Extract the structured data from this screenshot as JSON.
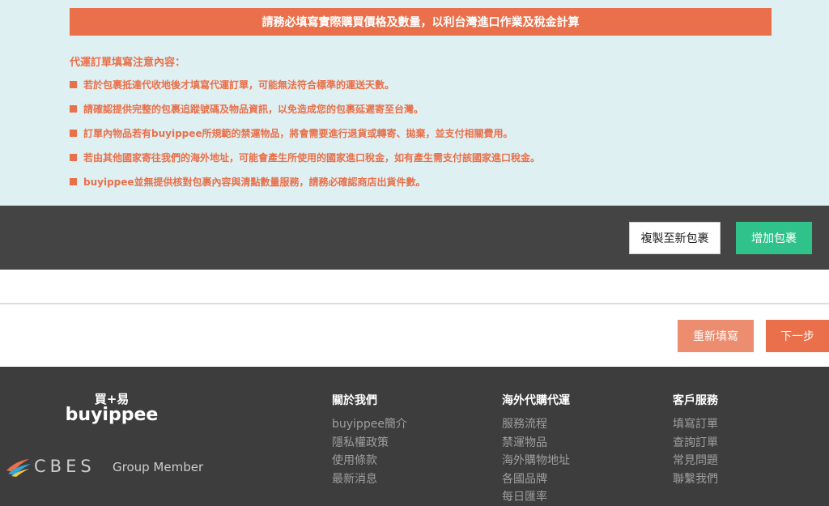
{
  "notice": {
    "banner": "請務必填寫實際購買價格及數量，以利台灣進口作業及稅金計算",
    "title": "代運訂單填寫注意內容：",
    "items": [
      "若於包裹抵達代收地後才填寫代運訂單，可能無法符合標準的運送天數。",
      "請確認提供完整的包裹追蹤號碼及物品資訊，以免造成您的包裹延遲寄至台灣。",
      "訂單內物品若有buyippee所規範的禁運物品，將會需要進行退貨或轉寄、拋棄，並支付相關費用。",
      "若由其他國家寄往我們的海外地址，可能會產生所使用的國家進口稅金，如有產生需支付該國家進口稅金。",
      "buyippee並無提供核對包裹內容與清點數量服務，請務必確認商店出貨件數。"
    ]
  },
  "actions": {
    "copy_label": "複製至新包裹",
    "add_label": "增加包裹"
  },
  "navigation": {
    "reset_label": "重新填寫",
    "next_label": "下一步"
  },
  "footer": {
    "logo": {
      "brand": "buyippee",
      "chinese": "買+易"
    },
    "group": {
      "brand": "CBES",
      "suffix": "Group Member"
    },
    "columns": [
      {
        "title": "關於我們",
        "links": [
          "buyippee簡介",
          "隱私權政策",
          "使用條款",
          "最新消息"
        ]
      },
      {
        "title": "海外代購代運",
        "links": [
          "服務流程",
          "禁運物品",
          "海外購物地址",
          "各國品牌",
          "每日匯率"
        ]
      },
      {
        "title": "客戶服務",
        "links": [
          "填寫訂單",
          "查詢訂單",
          "常見問題",
          "聯繫我們"
        ]
      }
    ]
  },
  "colors": {
    "accent": "#e9704a",
    "notice_bg": "#dff0f3",
    "action_bar": "#444444",
    "add_button": "#2fc38b",
    "footer_bg": "#3d3d3d"
  }
}
